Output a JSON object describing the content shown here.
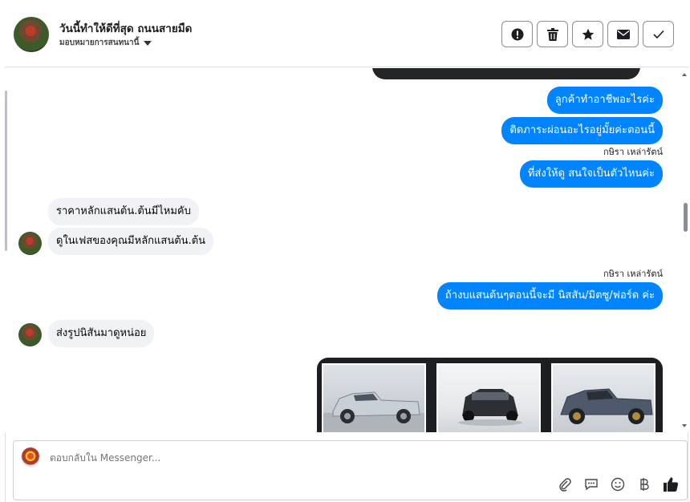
{
  "header": {
    "title": "วันนี้ทำให้ดีที่สุด ถนนสายมืด",
    "assign_label": "มอบหมายการสนทนานี้"
  },
  "actions": [
    "exclamation-icon",
    "trash-icon",
    "star-icon",
    "mail-icon",
    "check-icon"
  ],
  "messages": {
    "out1": "ลูกค้าทำอาชีพอะไรค่ะ",
    "out2": "ติดภาระผ่อนอะไรอยู่มั้ยค่ะตอนนี้",
    "sender1": "กษิรา เหล่ารัตน์",
    "out3": "ที่ส่งให้ดู สนใจเป็นตัวไหนค่ะ",
    "in1": "ราคาหลักแสนต้น.ต้นมีไหมคับ",
    "in2": "ดูในเฟสของคุณมีหลักแสนต้น.ต้น",
    "sender2": "กษิรา เหล่ารัตน์",
    "out4": "ถ้างบแสนต้นๆตอนนี้จะมี นิสสัน/มิตซู/ฟอร์ด ค่ะ",
    "in3": "ส่งรูปนิสันมาดูหน่อย"
  },
  "composer": {
    "placeholder": "ตอบกลับใน Messenger..."
  },
  "tools": [
    "paperclip-icon",
    "chat-icon",
    "smiley-icon",
    "baht-icon",
    "thumbs-up-icon"
  ],
  "colors": {
    "outgoing": "#0084ff",
    "incoming": "#f0f2f5",
    "gallery_bg": "#1c1e21"
  }
}
